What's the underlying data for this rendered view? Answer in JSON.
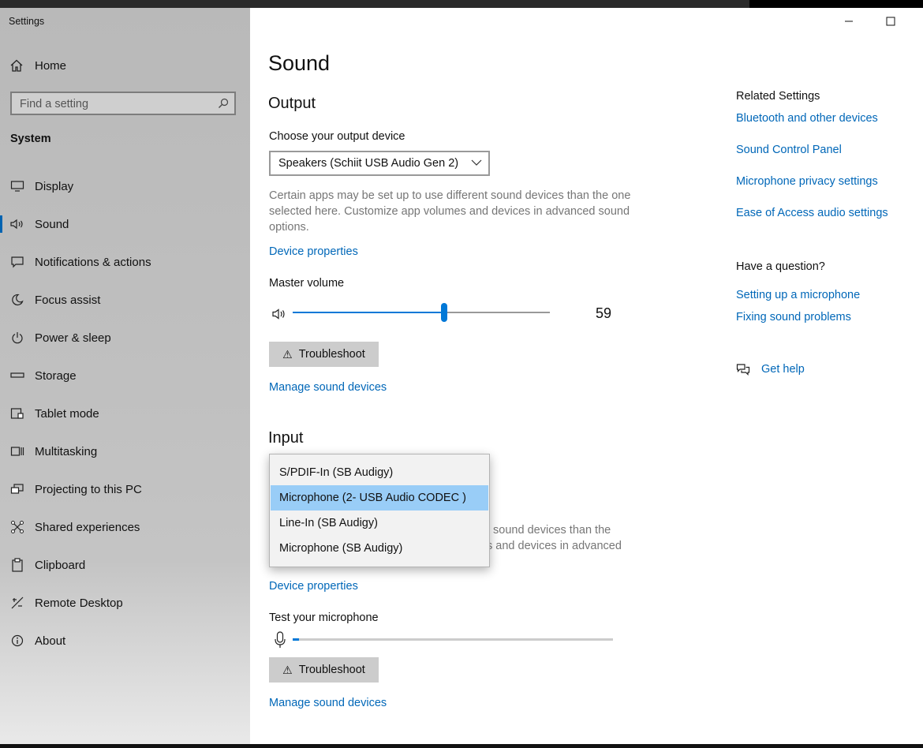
{
  "window": {
    "title": "Settings",
    "minimize_icon": "minimize-icon",
    "maximize_icon": "maximize-icon"
  },
  "sidebar": {
    "home_label": "Home",
    "search_placeholder": "Find a setting",
    "section_title": "System",
    "items": [
      {
        "label": "Display",
        "icon": "display-icon"
      },
      {
        "label": "Sound",
        "icon": "speaker-icon",
        "active": true
      },
      {
        "label": "Notifications & actions",
        "icon": "notifications-icon"
      },
      {
        "label": "Focus assist",
        "icon": "moon-icon"
      },
      {
        "label": "Power & sleep",
        "icon": "power-icon"
      },
      {
        "label": "Storage",
        "icon": "storage-icon"
      },
      {
        "label": "Tablet mode",
        "icon": "tablet-icon"
      },
      {
        "label": "Multitasking",
        "icon": "multitasking-icon"
      },
      {
        "label": "Projecting to this PC",
        "icon": "projecting-icon"
      },
      {
        "label": "Shared experiences",
        "icon": "shared-icon"
      },
      {
        "label": "Clipboard",
        "icon": "clipboard-icon"
      },
      {
        "label": "Remote Desktop",
        "icon": "remote-desktop-icon"
      },
      {
        "label": "About",
        "icon": "info-icon"
      }
    ]
  },
  "main": {
    "title": "Sound",
    "output": {
      "heading": "Output",
      "choose_label": "Choose your output device",
      "selected_device": "Speakers (Schiit USB Audio Gen 2)",
      "description": "Certain apps may be set up to use different sound devices than the one selected here. Customize app volumes and devices in advanced sound options.",
      "device_properties": "Device properties",
      "master_volume_label": "Master volume",
      "volume_value": "59",
      "volume_level": 59,
      "troubleshoot": "Troubleshoot",
      "manage_devices": "Manage sound devices"
    },
    "input": {
      "heading": "Input",
      "dropdown_options": [
        "S/PDIF-In (SB Audigy)",
        "Microphone (2- USB Audio CODEC )",
        "Line-In (SB Audigy)",
        "Microphone (SB Audigy)"
      ],
      "selected_index": 1,
      "description_fragment_1": "t sound devices than the",
      "description_fragment_2": "s and devices in advanced",
      "device_properties": "Device properties",
      "test_label": "Test your microphone",
      "mic_level": 2,
      "troubleshoot": "Troubleshoot",
      "manage_devices": "Manage sound devices"
    }
  },
  "related": {
    "title": "Related Settings",
    "links": [
      "Bluetooth and other devices",
      "Sound Control Panel",
      "Microphone privacy settings",
      "Ease of Access audio settings"
    ],
    "question_title": "Have a question?",
    "question_links": [
      "Setting up a microphone",
      "Fixing sound problems"
    ],
    "get_help": "Get help"
  }
}
